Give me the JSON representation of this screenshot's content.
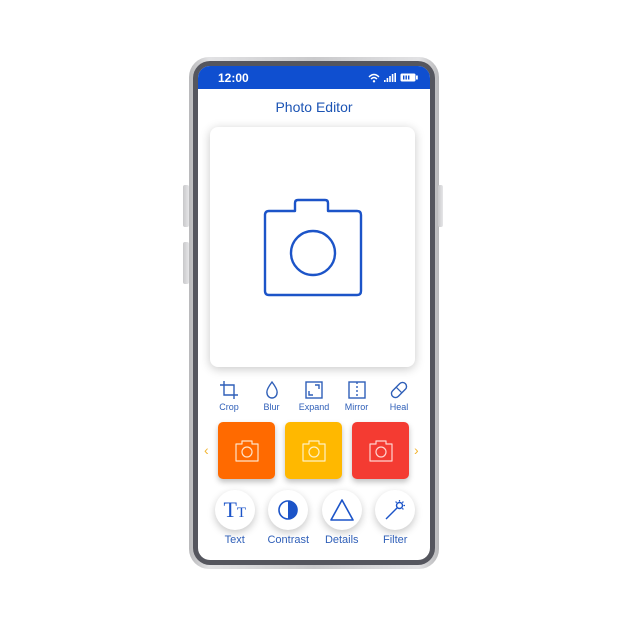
{
  "status_bar": {
    "time": "12:00",
    "icons": [
      "wifi-icon",
      "signal-icon",
      "battery-icon"
    ]
  },
  "header": {
    "title": "Photo Editor"
  },
  "preview": {
    "icon": "camera-icon"
  },
  "tools": [
    {
      "label": "Crop",
      "icon": "crop-icon"
    },
    {
      "label": "Blur",
      "icon": "droplet-icon"
    },
    {
      "label": "Expand",
      "icon": "expand-icon"
    },
    {
      "label": "Mirror",
      "icon": "mirror-icon"
    },
    {
      "label": "Heal",
      "icon": "bandage-icon"
    }
  ],
  "filters": {
    "prev_arrow": "‹",
    "next_arrow": "›",
    "arrow_color": "#f2b531",
    "items": [
      {
        "name": "orange",
        "color": "#ff6a00"
      },
      {
        "name": "yellow",
        "color": "#ffb800"
      },
      {
        "name": "red",
        "color": "#f43b32"
      }
    ]
  },
  "actions": [
    {
      "label": "Text",
      "icon": "text-icon",
      "glyph": "TT"
    },
    {
      "label": "Contrast",
      "icon": "contrast-icon"
    },
    {
      "label": "Details",
      "icon": "triangle-icon"
    },
    {
      "label": "Filter",
      "icon": "magic-wand-icon"
    }
  ],
  "colors": {
    "accent": "#0f4fd0",
    "text": "#1c54b4",
    "frame": "#55565e"
  }
}
